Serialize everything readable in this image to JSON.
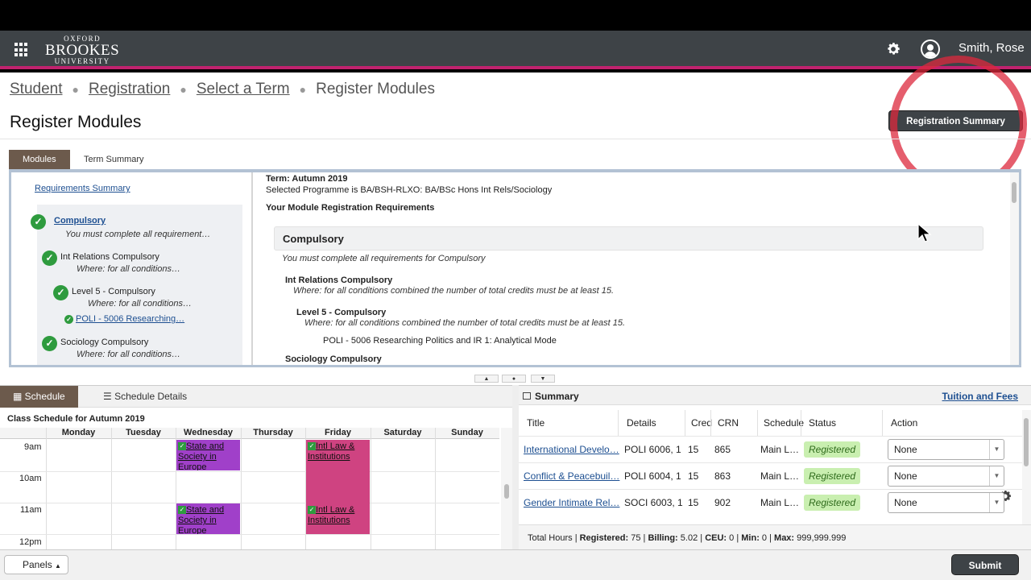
{
  "header": {
    "logo_line1": "OXFORD",
    "logo_line2": "BROOKES",
    "logo_line3": "UNIVERSITY",
    "user_name": "Smith, Rose"
  },
  "breadcrumb": [
    "Student",
    "Registration",
    "Select a Term",
    "Register Modules"
  ],
  "page_title": "Register Modules",
  "registration_summary_button": "Registration Summary",
  "tabs": {
    "modules": "Modules",
    "term_summary": "Term Summary"
  },
  "requirements_panel": {
    "link": "Requirements Summary",
    "items": [
      {
        "title": "Compulsory",
        "desc": "You must complete all requirement…"
      },
      {
        "title": "Int Relations Compulsory",
        "desc": "Where: for all conditions…"
      },
      {
        "title": "Level 5 - Compulsory",
        "desc": "Where: for all conditions…"
      },
      {
        "title": "POLI - 5006 Researching…"
      },
      {
        "title": "Sociology Compulsory",
        "desc": "Where: for all conditions…"
      }
    ]
  },
  "details": {
    "term": "Term: Autumn 2019",
    "programme": "Selected Programme is BA/BSH-RLXO: BA/BSc Hons Int Rels/Sociology",
    "req_heading": "Your Module Registration Requirements",
    "compulsory_heading": "Compulsory",
    "compulsory_desc": "You must complete all requirements for Compulsory",
    "ir_heading": "Int Relations Compulsory",
    "ir_desc": "Where: for all conditions combined the number of total credits must be at least 15.",
    "l5_heading": "Level 5 - Compulsory",
    "l5_desc": "Where: for all conditions combined the number of total credits must be at least 15.",
    "poli_line": "POLI - 5006 Researching Politics and IR 1: Analytical Mode",
    "soc_heading": "Sociology Compulsory"
  },
  "schedule": {
    "tab_schedule": "Schedule",
    "tab_details": "Schedule Details",
    "title": "Class Schedule for Autumn 2019",
    "days": [
      "Monday",
      "Tuesday",
      "Wednesday",
      "Thursday",
      "Friday",
      "Saturday",
      "Sunday"
    ],
    "times": [
      "9am",
      "10am",
      "11am",
      "12pm"
    ],
    "events": [
      {
        "label": "State and Society in Europe",
        "color": "#a040c9"
      },
      {
        "label": "Intl Law & Institutions",
        "color": "#cf4381"
      },
      {
        "label": "State and Society in Europe",
        "color": "#a040c9"
      },
      {
        "label": "Intl Law & Institutions",
        "color": "#cf4381"
      }
    ]
  },
  "summary": {
    "title": "Summary",
    "tuition_link": "Tuition and Fees",
    "columns": [
      "Title",
      "Details",
      "Cred",
      "CRN",
      "Schedule",
      "Status",
      "Action"
    ],
    "rows": [
      {
        "title": "International Develo…",
        "details": "POLI 6006, 1",
        "cred": "15",
        "crn": "865",
        "schedule": "Main L…",
        "status": "Registered",
        "action": "None"
      },
      {
        "title": "Conflict & Peacebuil…",
        "details": "POLI 6004, 1",
        "cred": "15",
        "crn": "863",
        "schedule": "Main L…",
        "status": "Registered",
        "action": "None"
      },
      {
        "title": "Gender Intimate Rel…",
        "details": "SOCI 6003, 1",
        "cred": "15",
        "crn": "902",
        "schedule": "Main L…",
        "status": "Registered",
        "action": "None"
      }
    ],
    "totals": {
      "prefix": "Total Hours | ",
      "registered_label": "Registered:",
      "registered": "75",
      "billing_label": "Billing:",
      "billing": "5.02",
      "ceu_label": "CEU:",
      "ceu": "0",
      "min_label": "Min:",
      "min": "0",
      "max_label": "Max:",
      "max": "999,999.999"
    }
  },
  "footer": {
    "panels": "Panels",
    "submit": "Submit"
  },
  "colors": {
    "header_bg": "#3e4347",
    "accent": "#c0226e",
    "registered_bg": "#c9efb0"
  }
}
